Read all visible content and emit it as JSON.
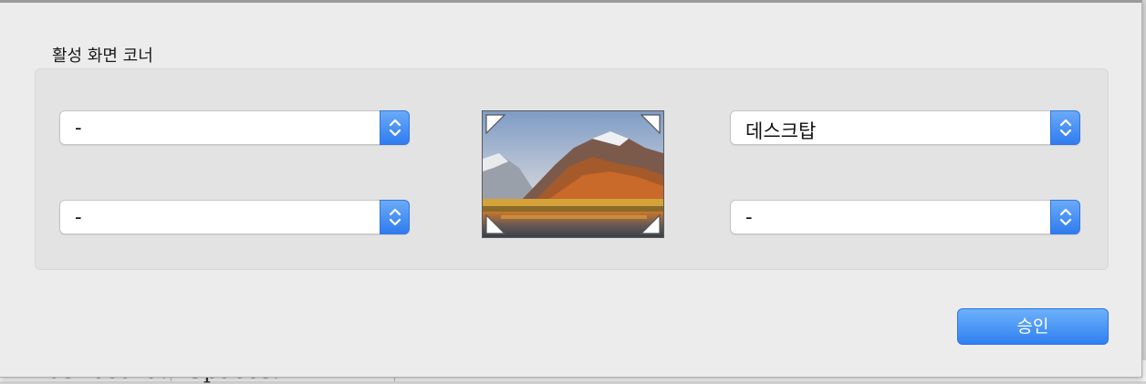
{
  "background_window": {
    "cells": [
      "Dashboard:",
      "Spaces:"
    ]
  },
  "dialog": {
    "section_title": "활성 화면 코너",
    "corners": {
      "top_left": {
        "value": "-"
      },
      "bottom_left": {
        "value": "-"
      },
      "top_right": {
        "value": "데스크탑"
      },
      "bottom_right": {
        "value": "-"
      }
    },
    "preview_icon": "desktop-wallpaper-mountain-lake",
    "ok_label": "승인"
  },
  "colors": {
    "accent": "#2f80f1",
    "sheet_bg": "#ececec",
    "group_bg": "#e3e3e3"
  }
}
